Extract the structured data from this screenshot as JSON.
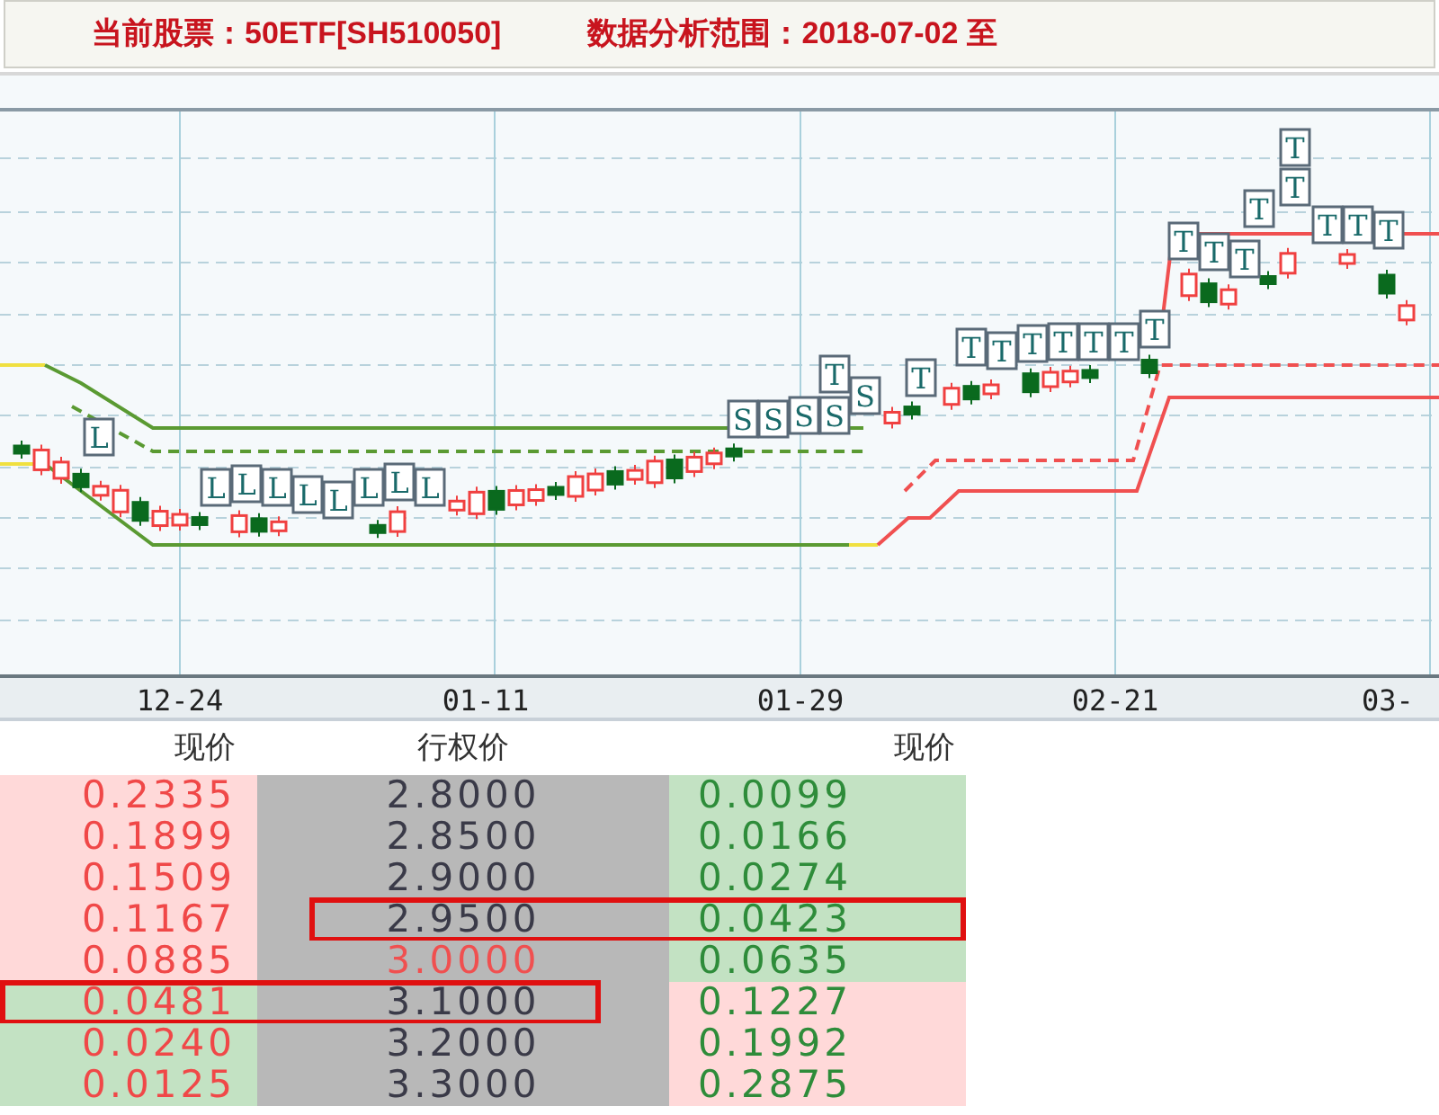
{
  "header": {
    "stock_label": "当前股票：",
    "stock_value": "50ETF[SH510050]",
    "range_label": "数据分析范围：",
    "range_value": "2018-07-02 至"
  },
  "chart": {
    "x_labels": [
      "12-24",
      "01-11",
      "01-29",
      "02-21",
      "03-"
    ],
    "signals": [
      {
        "text": "L"
      },
      {
        "text": "L"
      },
      {
        "text": "L"
      },
      {
        "text": "L"
      },
      {
        "text": "L"
      },
      {
        "text": "L"
      },
      {
        "text": "L"
      },
      {
        "text": "L"
      },
      {
        "text": "L"
      },
      {
        "text": "S"
      },
      {
        "text": "S"
      },
      {
        "text": "S"
      },
      {
        "text": "S"
      },
      {
        "text": "T"
      },
      {
        "text": "S"
      },
      {
        "text": "T"
      },
      {
        "text": "T"
      },
      {
        "text": "T"
      },
      {
        "text": "T"
      },
      {
        "text": "T"
      },
      {
        "text": "T"
      },
      {
        "text": "T"
      },
      {
        "text": "T"
      },
      {
        "text": "T"
      },
      {
        "text": "T"
      },
      {
        "text": "T"
      },
      {
        "text": "T"
      },
      {
        "text": "T"
      },
      {
        "text": "T"
      },
      {
        "text": "T"
      },
      {
        "text": "T"
      },
      {
        "text": "T"
      }
    ]
  },
  "table": {
    "columns": [
      "现价",
      "行权价",
      "现价"
    ],
    "rows": [
      {
        "call": "0.2335",
        "call_in_the_money": true,
        "strike": "2.8000",
        "at_the_money": false,
        "put": "0.0099",
        "put_in_the_money": false,
        "left_highlighted": false,
        "right_highlighted": false
      },
      {
        "call": "0.1899",
        "call_in_the_money": true,
        "strike": "2.8500",
        "at_the_money": false,
        "put": "0.0166",
        "put_in_the_money": false,
        "left_highlighted": false,
        "right_highlighted": false
      },
      {
        "call": "0.1509",
        "call_in_the_money": true,
        "strike": "2.9000",
        "at_the_money": false,
        "put": "0.0274",
        "put_in_the_money": false,
        "left_highlighted": false,
        "right_highlighted": false
      },
      {
        "call": "0.1167",
        "call_in_the_money": true,
        "strike": "2.9500",
        "at_the_money": false,
        "put": "0.0423",
        "put_in_the_money": false,
        "left_highlighted": false,
        "right_highlighted": true
      },
      {
        "call": "0.0885",
        "call_in_the_money": true,
        "strike": "3.0000",
        "at_the_money": true,
        "put": "0.0635",
        "put_in_the_money": false,
        "left_highlighted": false,
        "right_highlighted": false
      },
      {
        "call": "0.0481",
        "call_in_the_money": false,
        "strike": "3.1000",
        "at_the_money": false,
        "put": "0.1227",
        "put_in_the_money": true,
        "left_highlighted": true,
        "right_highlighted": false
      },
      {
        "call": "0.0240",
        "call_in_the_money": false,
        "strike": "3.2000",
        "at_the_money": false,
        "put": "0.1992",
        "put_in_the_money": true,
        "left_highlighted": false,
        "right_highlighted": false
      },
      {
        "call": "0.0125",
        "call_in_the_money": false,
        "strike": "3.3000",
        "at_the_money": false,
        "put": "0.2875",
        "put_in_the_money": true,
        "left_highlighted": false,
        "right_highlighted": false
      }
    ]
  }
}
